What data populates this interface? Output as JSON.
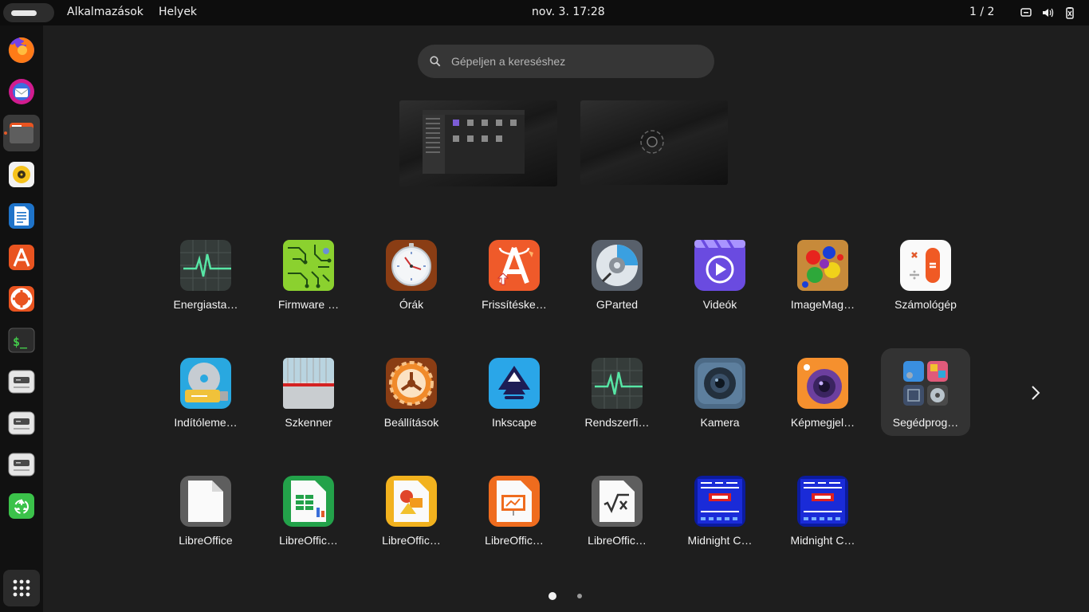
{
  "topbar": {
    "applications_menu": "Alkalmazások",
    "places_menu": "Helyek",
    "clock": "nov. 3.  17:28",
    "workspace_indicator": "1 / 2"
  },
  "search": {
    "placeholder": "Gépeljen a kereséshez"
  },
  "dock": {
    "items": [
      {
        "name": "firefox-icon"
      },
      {
        "name": "thunderbird-icon"
      },
      {
        "name": "files-icon",
        "running": true
      },
      {
        "name": "rhythmbox-icon"
      },
      {
        "name": "libreoffice-writer-icon"
      },
      {
        "name": "app-center-icon"
      },
      {
        "name": "help-icon"
      },
      {
        "name": "terminal-icon"
      },
      {
        "name": "drive-icon"
      },
      {
        "name": "drive-icon"
      },
      {
        "name": "drive-icon"
      },
      {
        "name": "trash-icon"
      }
    ],
    "show_apps_icon": "grid-icon"
  },
  "apps": [
    {
      "label": "Energiasta…",
      "icon": "power-statistics-icon"
    },
    {
      "label": "Firmware …",
      "icon": "firmware-icon"
    },
    {
      "label": "Órák",
      "icon": "clocks-icon"
    },
    {
      "label": "Frissítéske…",
      "icon": "software-updater-icon"
    },
    {
      "label": "GParted",
      "icon": "gparted-icon"
    },
    {
      "label": "Videók",
      "icon": "videos-icon"
    },
    {
      "label": "ImageMag…",
      "icon": "imagemagick-icon"
    },
    {
      "label": "Számológép",
      "icon": "calculator-icon"
    },
    {
      "label": "Indítóleme…",
      "icon": "startup-disk-creator-icon"
    },
    {
      "label": "Szkenner",
      "icon": "scanner-icon"
    },
    {
      "label": "Beállítások",
      "icon": "settings-icon"
    },
    {
      "label": "Inkscape",
      "icon": "inkscape-icon"
    },
    {
      "label": "Rendszerfi…",
      "icon": "system-monitor-icon"
    },
    {
      "label": "Kamera",
      "icon": "camera-icon"
    },
    {
      "label": "Képmegjel…",
      "icon": "image-viewer-icon"
    },
    {
      "label": "Segédprog…",
      "icon": "utilities-folder-icon"
    },
    {
      "label": "LibreOffice",
      "icon": "libreoffice-icon"
    },
    {
      "label": "LibreOffic…",
      "icon": "libreoffice-calc-icon"
    },
    {
      "label": "LibreOffic…",
      "icon": "libreoffice-draw-icon"
    },
    {
      "label": "LibreOffic…",
      "icon": "libreoffice-impress-icon"
    },
    {
      "label": "LibreOffic…",
      "icon": "libreoffice-math-icon"
    },
    {
      "label": "Midnight C…",
      "icon": "midnight-commander-icon"
    },
    {
      "label": "Midnight C…",
      "icon": "midnight-commander-icon"
    }
  ],
  "pagination": {
    "current_page": 1,
    "total_pages": 2
  },
  "colors": {
    "accent": "#e95420",
    "topbar": "#0d0d0d",
    "dock": "#111111",
    "background": "#1e1e1e"
  }
}
